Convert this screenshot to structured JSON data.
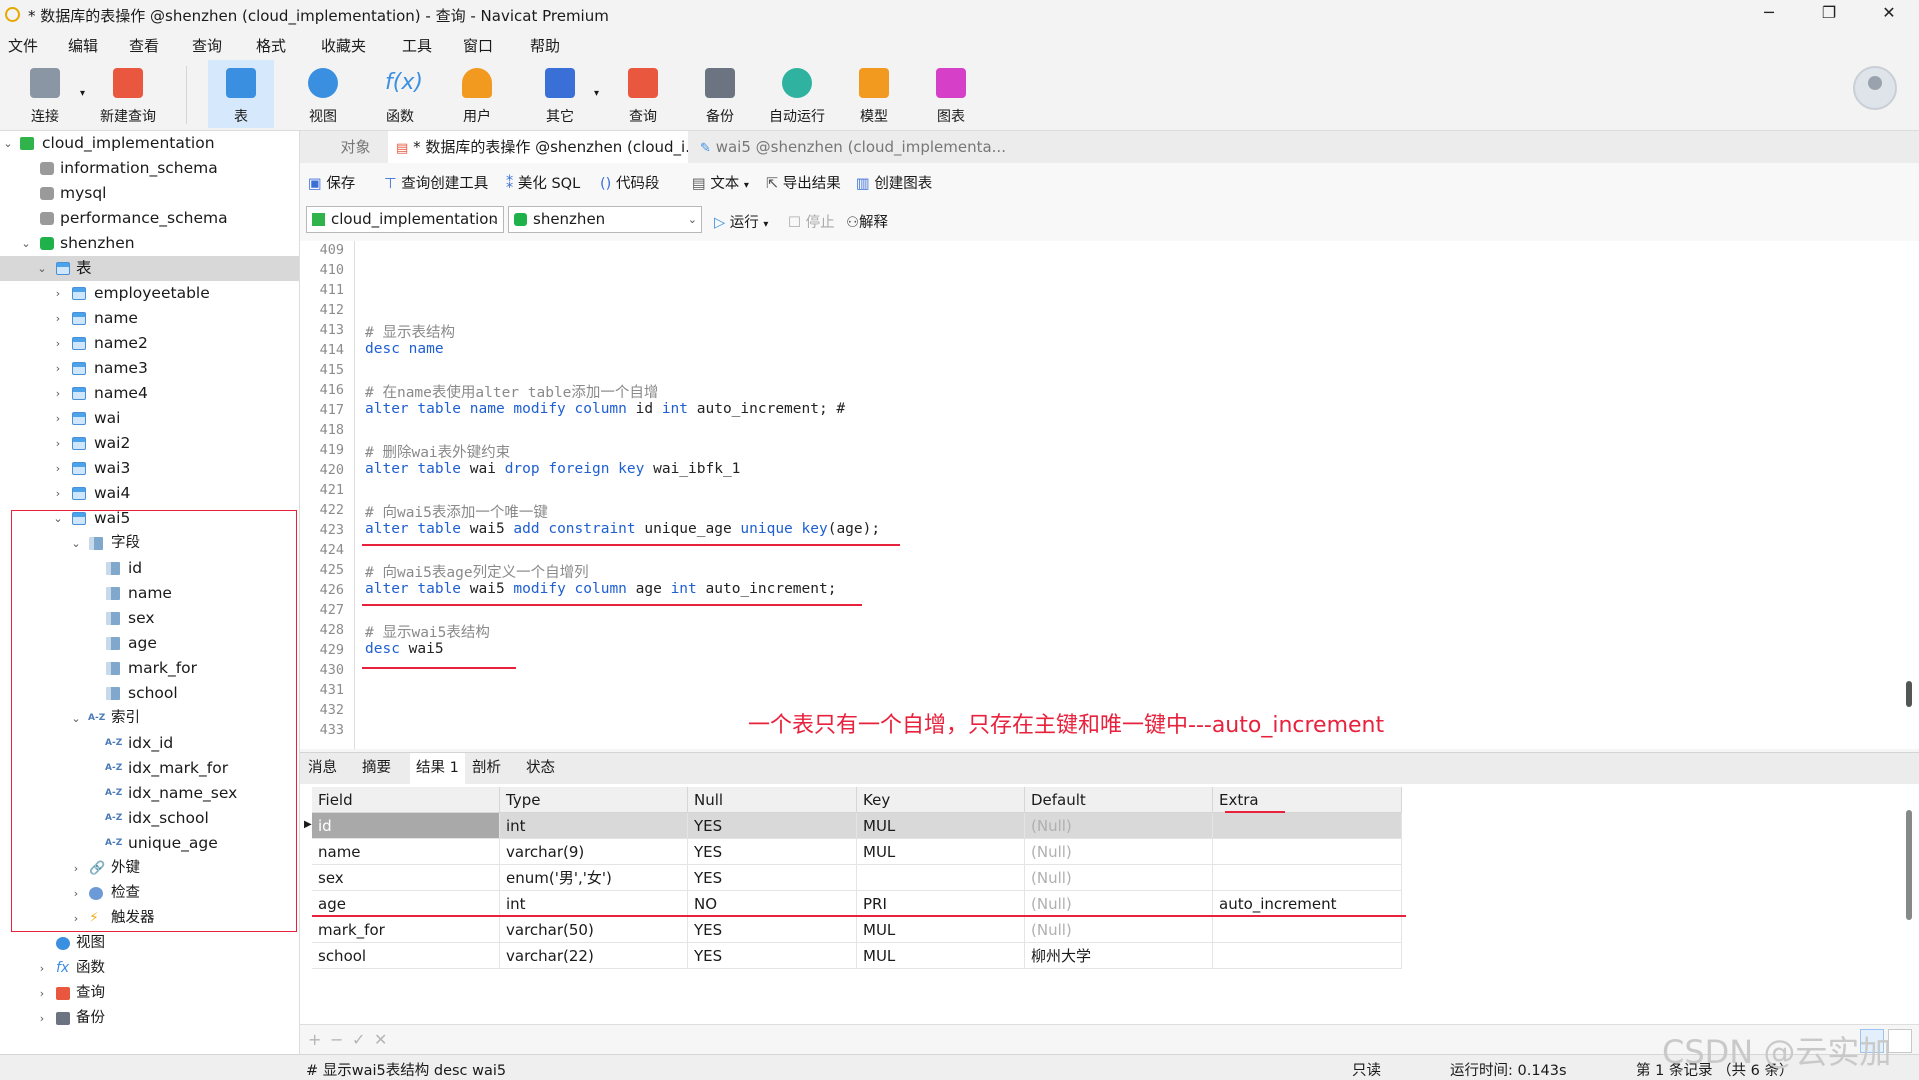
{
  "window": {
    "title": "* 数据库的表操作 @shenzhen (cloud_implementation) - 查询 - Navicat Premium",
    "controls": [
      "─",
      "❐",
      "✕"
    ]
  },
  "menu": [
    "文件",
    "编辑",
    "查看",
    "查询",
    "格式",
    "收藏夹",
    "工具",
    "窗口",
    "帮助"
  ],
  "toolbar": [
    {
      "label": "连接",
      "color": "#8a96a3"
    },
    {
      "label": "新建查询",
      "color": "#e8573e"
    },
    {
      "label": "表",
      "color": "#3b8fe0"
    },
    {
      "label": "视图",
      "color": "#3b8fe0"
    },
    {
      "label": "函数",
      "color": "#3b8fe0"
    },
    {
      "label": "用户",
      "color": "#f29a1f"
    },
    {
      "label": "其它",
      "color": "#3b6fd8"
    },
    {
      "label": "查询",
      "color": "#e8573e"
    },
    {
      "label": "备份",
      "color": "#6b7480"
    },
    {
      "label": "自动运行",
      "color": "#2fb3a0"
    },
    {
      "label": "模型",
      "color": "#f29a1f"
    },
    {
      "label": "图表",
      "color": "#d640c8"
    }
  ],
  "tree": {
    "connection": "cloud_implementation",
    "dbs": [
      "information_schema",
      "mysql",
      "performance_schema"
    ],
    "db": "shenzhen",
    "tables_label": "表",
    "tables": [
      "employeetable",
      "name",
      "name2",
      "name3",
      "name4",
      "wai",
      "wai2",
      "wai3",
      "wai4"
    ],
    "wai5": "wai5",
    "fields_label": "字段",
    "fields": [
      "id",
      "name",
      "sex",
      "age",
      "mark_for",
      "school"
    ],
    "index_label": "索引",
    "indexes": [
      "idx_id",
      "idx_mark_for",
      "idx_name_sex",
      "idx_school",
      "unique_age"
    ],
    "fk_label": "外键",
    "check_label": "检查",
    "trigger_label": "触发器",
    "views_label": "视图",
    "funcs_label": "函数",
    "queries_label": "查询",
    "backup_label": "备份"
  },
  "tabs": {
    "objects": "对象",
    "query1": "* 数据库的表操作 @shenzhen (cloud_i...",
    "query2": "wai5 @shenzhen (cloud_implementa..."
  },
  "editor_toolbar": {
    "save": "保存",
    "builder": "查询创建工具",
    "beautify": "美化 SQL",
    "snippet": "代码段",
    "text": "文本",
    "export": "导出结果",
    "chart": "创建图表",
    "conn_select": "cloud_implementation",
    "db_select": "shenzhen",
    "run": "运行",
    "stop": "停止",
    "explain": "解释"
  },
  "code": {
    "line_numbers": [
      "409",
      "410",
      "411",
      "412",
      "413",
      "414",
      "415",
      "416",
      "417",
      "418",
      "419",
      "420",
      "421",
      "422",
      "423",
      "424",
      "425",
      "426",
      "427",
      "428",
      "429",
      "430",
      "431",
      "432",
      "433"
    ],
    "l413": "# 显示表结构",
    "l414_kw": "desc",
    "l414_rest": " name",
    "l416": "# 在name表使用alter table添加一个自增",
    "l417_kw1": "alter table name modify column",
    "l417_t1": " id ",
    "l417_kw2": "int",
    "l417_t2": " auto_increment; #",
    "l419": "# 删除wai表外键约束",
    "l420_kw1": "alter table",
    "l420_t1": " wai ",
    "l420_kw2": "drop foreign key",
    "l420_t2": " wai_ibfk_1",
    "l422": "# 向wai5表添加一个唯一键",
    "l423_kw1": "alter table",
    "l423_t1": " wai5 ",
    "l423_kw2": "add constraint",
    "l423_t2": " unique_age ",
    "l423_kw3": "unique key",
    "l423_t3": "(age);",
    "l425": "# 向wai5表age列定义一个自增列",
    "l426_kw1": "alter table",
    "l426_t1": " wai5 ",
    "l426_kw2": "modify column",
    "l426_t2": " age ",
    "l426_kw3": "int",
    "l426_t3": " auto_increment;",
    "l428": "# 显示wai5表结构",
    "l429_kw": "desc",
    "l429_rest": " wai5",
    "annotation": "一个表只有一个自增，只存在主键和唯一键中---auto_increment"
  },
  "result_tabs": [
    "消息",
    "摘要",
    "结果 1",
    "剖析",
    "状态"
  ],
  "grid": {
    "headers": [
      "Field",
      "Type",
      "Null",
      "Key",
      "Default",
      "Extra"
    ],
    "rows": [
      [
        "id",
        "int",
        "YES",
        "MUL",
        "(Null)",
        ""
      ],
      [
        "name",
        "varchar(9)",
        "YES",
        "MUL",
        "(Null)",
        ""
      ],
      [
        "sex",
        "enum('男','女')",
        "YES",
        "",
        "(Null)",
        ""
      ],
      [
        "age",
        "int",
        "NO",
        "PRI",
        "(Null)",
        "auto_increment"
      ],
      [
        "mark_for",
        "varchar(50)",
        "YES",
        "MUL",
        "(Null)",
        ""
      ],
      [
        "school",
        "varchar(22)",
        "YES",
        "MUL",
        "柳州大学",
        ""
      ]
    ]
  },
  "grid_bar": [
    "+",
    "−",
    "✓",
    "✕"
  ],
  "status": {
    "sql": "# 显示wai5表结构 desc wai5",
    "readonly": "只读",
    "time": "运行时间: 0.143s",
    "records": "第 1 条记录 （共 6 条）"
  },
  "watermark": "CSDN @云实加"
}
